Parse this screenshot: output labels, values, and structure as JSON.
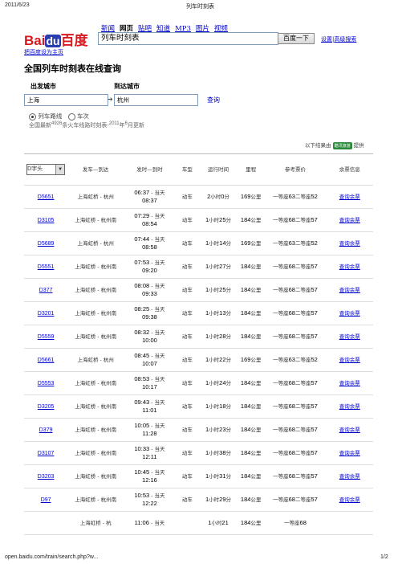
{
  "print_header": {
    "date": "2011/6/23",
    "title": "列车时刻表"
  },
  "print_footer": {
    "url": "open.baidu.com/train/search.php?w...",
    "page": "1/2"
  },
  "nav": {
    "items": [
      "新闻",
      "网页",
      "贴吧",
      "知道",
      "MP3",
      "图片",
      "视频"
    ],
    "current": "网页"
  },
  "logo": {
    "bai": "Bai",
    "du": "du",
    "cn": "百度"
  },
  "search": {
    "value": "列车时刻表",
    "button": "百度一下",
    "settings": "设置",
    "advanced": "高级搜索"
  },
  "set_home": "把百度设为主页",
  "title": "全国列车时刻表在线查询",
  "form": {
    "from_label": "出发城市",
    "to_label": "到达城市",
    "from_value": "上海",
    "to_value": "杭州",
    "arrow": "➔",
    "query": "查询",
    "radio1": "列车路线",
    "radio2": "车次",
    "stat_prefix": "全国最新",
    "stat_count": "4926",
    "stat_mid": "条火车线路时刻表-",
    "stat_year": "2011",
    "stat_year_unit": "年",
    "stat_month": "6",
    "stat_suffix": "月更新"
  },
  "provider": {
    "prefix": "以下结果由",
    "name": "酷讯旅游",
    "suffix": "提供"
  },
  "table": {
    "filter": "D字头",
    "headers": [
      "发车—到达",
      "发时—到时",
      "车型",
      "运行时间",
      "里程",
      "参考票价",
      "余票信息"
    ],
    "ticket_link": "查询余票",
    "rows": [
      {
        "code": "D5651",
        "route": "上海虹桥 - 杭州",
        "dep": "06:37",
        "arr": "08:37",
        "type": "动车",
        "dur_h": "2",
        "dur_m": "0",
        "km": "169",
        "p1": "63",
        "p2": "52"
      },
      {
        "code": "D3105",
        "route": "上海虹桥 - 杭州南",
        "dep": "07:29",
        "arr": "08:54",
        "type": "动车",
        "dur_h": "1",
        "dur_m": "25",
        "km": "184",
        "p1": "68",
        "p2": "57"
      },
      {
        "code": "D5689",
        "route": "上海虹桥 - 杭州",
        "dep": "07:44",
        "arr": "08:58",
        "type": "动车",
        "dur_h": "1",
        "dur_m": "14",
        "km": "169",
        "p1": "63",
        "p2": "52"
      },
      {
        "code": "D5551",
        "route": "上海虹桥 - 杭州南",
        "dep": "07:53",
        "arr": "09:20",
        "type": "动车",
        "dur_h": "1",
        "dur_m": "27",
        "km": "184",
        "p1": "68",
        "p2": "57"
      },
      {
        "code": "D377",
        "route": "上海虹桥 - 杭州南",
        "dep": "08:08",
        "arr": "09:33",
        "type": "动车",
        "dur_h": "1",
        "dur_m": "25",
        "km": "184",
        "p1": "68",
        "p2": "57"
      },
      {
        "code": "D3201",
        "route": "上海虹桥 - 杭州南",
        "dep": "08:25",
        "arr": "09:38",
        "type": "动车",
        "dur_h": "1",
        "dur_m": "13",
        "km": "184",
        "p1": "68",
        "p2": "57"
      },
      {
        "code": "D5559",
        "route": "上海虹桥 - 杭州南",
        "dep": "08:32",
        "arr": "10:00",
        "type": "动车",
        "dur_h": "1",
        "dur_m": "28",
        "km": "184",
        "p1": "68",
        "p2": "57"
      },
      {
        "code": "D5661",
        "route": "上海虹桥 - 杭州",
        "dep": "08:45",
        "arr": "10:07",
        "type": "动车",
        "dur_h": "1",
        "dur_m": "22",
        "km": "169",
        "p1": "63",
        "p2": "52"
      },
      {
        "code": "D5553",
        "route": "上海虹桥 - 杭州南",
        "dep": "08:53",
        "arr": "10:17",
        "type": "动车",
        "dur_h": "1",
        "dur_m": "24",
        "km": "184",
        "p1": "68",
        "p2": "57"
      },
      {
        "code": "D3205",
        "route": "上海虹桥 - 杭州南",
        "dep": "09:43",
        "arr": "11:01",
        "type": "动车",
        "dur_h": "1",
        "dur_m": "18",
        "km": "184",
        "p1": "68",
        "p2": "57"
      },
      {
        "code": "D379",
        "route": "上海虹桥 - 杭州南",
        "dep": "10:05",
        "arr": "11:28",
        "type": "动车",
        "dur_h": "1",
        "dur_m": "23",
        "km": "184",
        "p1": "68",
        "p2": "57"
      },
      {
        "code": "D3107",
        "route": "上海虹桥 - 杭州南",
        "dep": "10:33",
        "arr": "12:11",
        "type": "动车",
        "dur_h": "1",
        "dur_m": "38",
        "km": "184",
        "p1": "68",
        "p2": "57"
      },
      {
        "code": "D3203",
        "route": "上海虹桥 - 杭州南",
        "dep": "10:45",
        "arr": "12:16",
        "type": "动车",
        "dur_h": "1",
        "dur_m": "31",
        "km": "184",
        "p1": "68",
        "p2": "57"
      },
      {
        "code": "D97",
        "route": "上海虹桥 - 杭州南",
        "dep": "10:53",
        "arr": "12:22",
        "type": "动车",
        "dur_h": "1",
        "dur_m": "29",
        "km": "184",
        "p1": "68",
        "p2": "57"
      }
    ],
    "partial_row": {
      "route": "上海虹桥 - 杭",
      "dep": "11:06",
      "dur_h": "1",
      "dur_m": "21",
      "km": "184",
      "p1": "68"
    },
    "labels": {
      "today": "当天",
      "hour": "小时",
      "min": "分",
      "km_unit": "公里",
      "first": "一等座",
      "second": "二等座"
    }
  },
  "colors": {
    "link": "#0000cc",
    "logo_red": "#d8191f",
    "logo_blue": "#2b3eb1"
  }
}
